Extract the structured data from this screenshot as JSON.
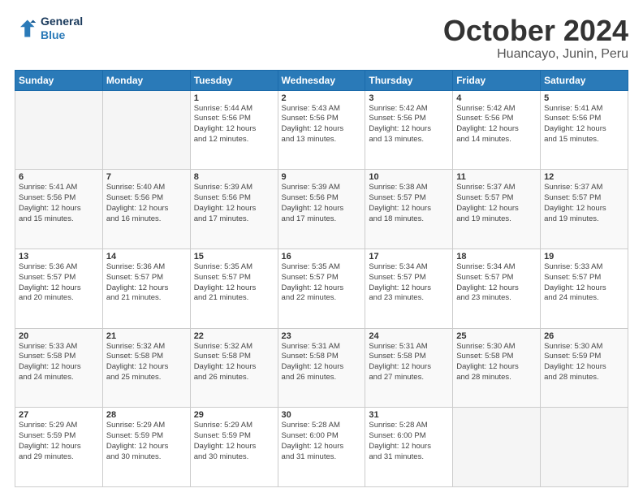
{
  "header": {
    "logo": {
      "line1": "General",
      "line2": "Blue"
    },
    "title": "October 2024",
    "location": "Huancayo, Junin, Peru"
  },
  "days_of_week": [
    "Sunday",
    "Monday",
    "Tuesday",
    "Wednesday",
    "Thursday",
    "Friday",
    "Saturday"
  ],
  "weeks": [
    [
      {
        "day": "",
        "info": ""
      },
      {
        "day": "",
        "info": ""
      },
      {
        "day": "1",
        "info": "Sunrise: 5:44 AM\nSunset: 5:56 PM\nDaylight: 12 hours\nand 12 minutes."
      },
      {
        "day": "2",
        "info": "Sunrise: 5:43 AM\nSunset: 5:56 PM\nDaylight: 12 hours\nand 13 minutes."
      },
      {
        "day": "3",
        "info": "Sunrise: 5:42 AM\nSunset: 5:56 PM\nDaylight: 12 hours\nand 13 minutes."
      },
      {
        "day": "4",
        "info": "Sunrise: 5:42 AM\nSunset: 5:56 PM\nDaylight: 12 hours\nand 14 minutes."
      },
      {
        "day": "5",
        "info": "Sunrise: 5:41 AM\nSunset: 5:56 PM\nDaylight: 12 hours\nand 15 minutes."
      }
    ],
    [
      {
        "day": "6",
        "info": "Sunrise: 5:41 AM\nSunset: 5:56 PM\nDaylight: 12 hours\nand 15 minutes."
      },
      {
        "day": "7",
        "info": "Sunrise: 5:40 AM\nSunset: 5:56 PM\nDaylight: 12 hours\nand 16 minutes."
      },
      {
        "day": "8",
        "info": "Sunrise: 5:39 AM\nSunset: 5:56 PM\nDaylight: 12 hours\nand 17 minutes."
      },
      {
        "day": "9",
        "info": "Sunrise: 5:39 AM\nSunset: 5:56 PM\nDaylight: 12 hours\nand 17 minutes."
      },
      {
        "day": "10",
        "info": "Sunrise: 5:38 AM\nSunset: 5:57 PM\nDaylight: 12 hours\nand 18 minutes."
      },
      {
        "day": "11",
        "info": "Sunrise: 5:37 AM\nSunset: 5:57 PM\nDaylight: 12 hours\nand 19 minutes."
      },
      {
        "day": "12",
        "info": "Sunrise: 5:37 AM\nSunset: 5:57 PM\nDaylight: 12 hours\nand 19 minutes."
      }
    ],
    [
      {
        "day": "13",
        "info": "Sunrise: 5:36 AM\nSunset: 5:57 PM\nDaylight: 12 hours\nand 20 minutes."
      },
      {
        "day": "14",
        "info": "Sunrise: 5:36 AM\nSunset: 5:57 PM\nDaylight: 12 hours\nand 21 minutes."
      },
      {
        "day": "15",
        "info": "Sunrise: 5:35 AM\nSunset: 5:57 PM\nDaylight: 12 hours\nand 21 minutes."
      },
      {
        "day": "16",
        "info": "Sunrise: 5:35 AM\nSunset: 5:57 PM\nDaylight: 12 hours\nand 22 minutes."
      },
      {
        "day": "17",
        "info": "Sunrise: 5:34 AM\nSunset: 5:57 PM\nDaylight: 12 hours\nand 23 minutes."
      },
      {
        "day": "18",
        "info": "Sunrise: 5:34 AM\nSunset: 5:57 PM\nDaylight: 12 hours\nand 23 minutes."
      },
      {
        "day": "19",
        "info": "Sunrise: 5:33 AM\nSunset: 5:57 PM\nDaylight: 12 hours\nand 24 minutes."
      }
    ],
    [
      {
        "day": "20",
        "info": "Sunrise: 5:33 AM\nSunset: 5:58 PM\nDaylight: 12 hours\nand 24 minutes."
      },
      {
        "day": "21",
        "info": "Sunrise: 5:32 AM\nSunset: 5:58 PM\nDaylight: 12 hours\nand 25 minutes."
      },
      {
        "day": "22",
        "info": "Sunrise: 5:32 AM\nSunset: 5:58 PM\nDaylight: 12 hours\nand 26 minutes."
      },
      {
        "day": "23",
        "info": "Sunrise: 5:31 AM\nSunset: 5:58 PM\nDaylight: 12 hours\nand 26 minutes."
      },
      {
        "day": "24",
        "info": "Sunrise: 5:31 AM\nSunset: 5:58 PM\nDaylight: 12 hours\nand 27 minutes."
      },
      {
        "day": "25",
        "info": "Sunrise: 5:30 AM\nSunset: 5:58 PM\nDaylight: 12 hours\nand 28 minutes."
      },
      {
        "day": "26",
        "info": "Sunrise: 5:30 AM\nSunset: 5:59 PM\nDaylight: 12 hours\nand 28 minutes."
      }
    ],
    [
      {
        "day": "27",
        "info": "Sunrise: 5:29 AM\nSunset: 5:59 PM\nDaylight: 12 hours\nand 29 minutes."
      },
      {
        "day": "28",
        "info": "Sunrise: 5:29 AM\nSunset: 5:59 PM\nDaylight: 12 hours\nand 30 minutes."
      },
      {
        "day": "29",
        "info": "Sunrise: 5:29 AM\nSunset: 5:59 PM\nDaylight: 12 hours\nand 30 minutes."
      },
      {
        "day": "30",
        "info": "Sunrise: 5:28 AM\nSunset: 6:00 PM\nDaylight: 12 hours\nand 31 minutes."
      },
      {
        "day": "31",
        "info": "Sunrise: 5:28 AM\nSunset: 6:00 PM\nDaylight: 12 hours\nand 31 minutes."
      },
      {
        "day": "",
        "info": ""
      },
      {
        "day": "",
        "info": ""
      }
    ]
  ]
}
